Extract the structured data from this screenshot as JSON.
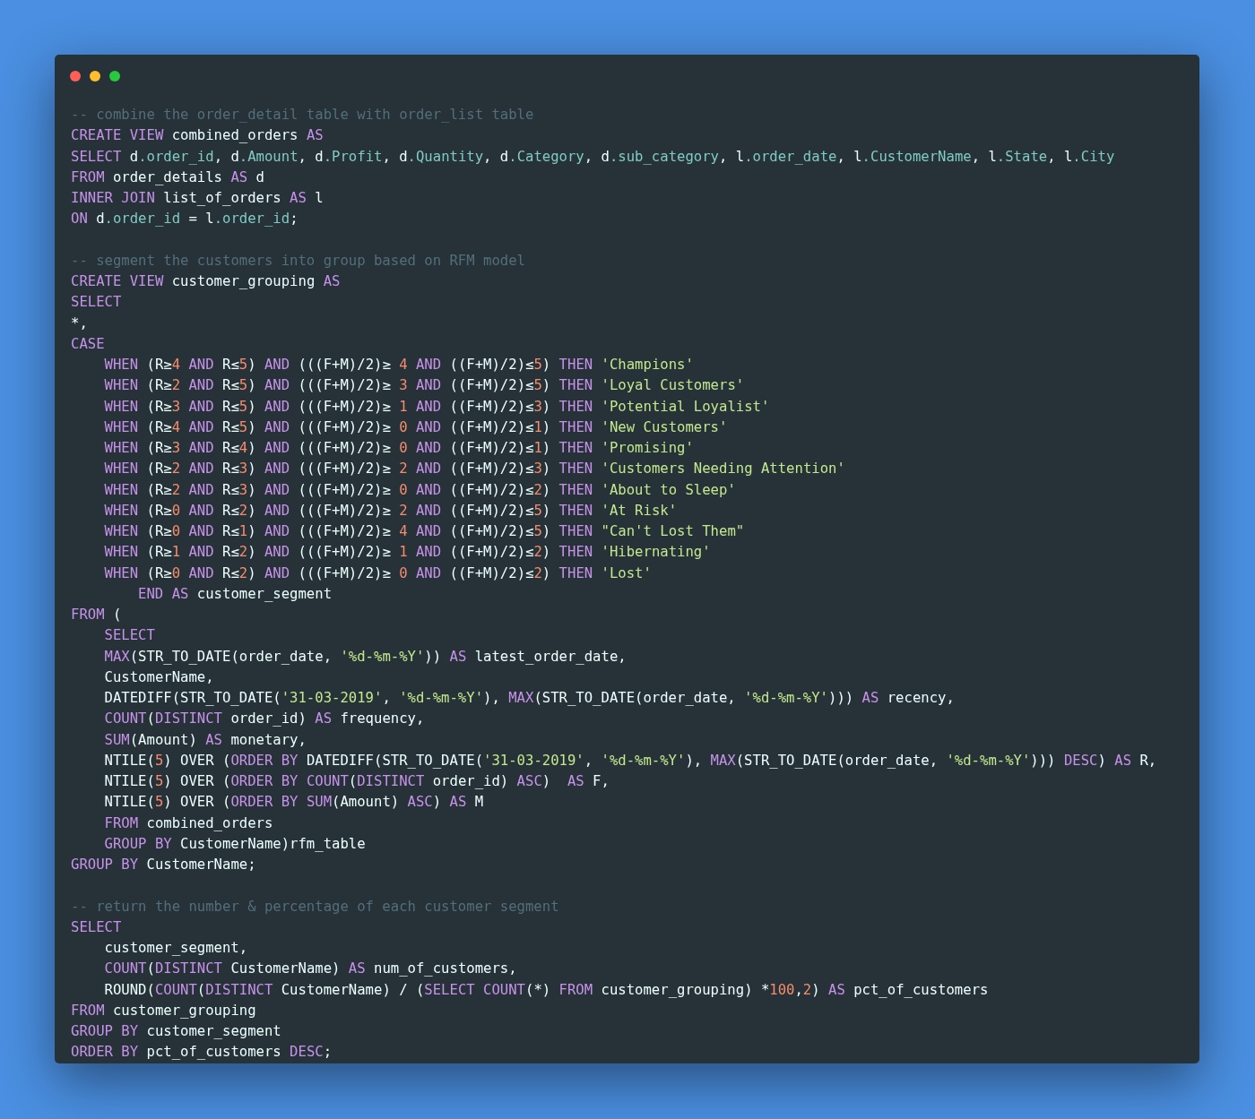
{
  "window": {
    "controls": [
      {
        "color": "#ff5f56"
      },
      {
        "color": "#ffbd2e"
      },
      {
        "color": "#27c93f"
      }
    ]
  },
  "code": {
    "blocks": [
      {
        "lines": [
          {
            "kind": "top",
            "tokens": [
              {
                "kind": "comment",
                "text": "-- combine the order_detail table with order_list table"
              }
            ]
          },
          {
            "kind": "top",
            "tokens": [
              {
                "kind": "keyword",
                "text": "CREATE VIEW"
              },
              {
                "kind": "text",
                "text": " combined_orders "
              },
              {
                "kind": "keyword",
                "text": "AS"
              }
            ]
          },
          {
            "kind": "top",
            "tokens": [
              {
                "kind": "keyword",
                "text": "SELECT"
              },
              {
                "kind": "text",
                "text": " d"
              },
              {
                "kind": "field",
                "text": ".order_id"
              },
              {
                "kind": "text",
                "text": ", d"
              },
              {
                "kind": "field",
                "text": ".Amount"
              },
              {
                "kind": "text",
                "text": ", d"
              },
              {
                "kind": "field",
                "text": ".Profit"
              },
              {
                "kind": "text",
                "text": ", d"
              },
              {
                "kind": "field",
                "text": ".Quantity"
              },
              {
                "kind": "text",
                "text": ", d"
              },
              {
                "kind": "field",
                "text": ".Category"
              },
              {
                "kind": "text",
                "text": ", d"
              },
              {
                "kind": "field",
                "text": ".sub_category"
              },
              {
                "kind": "text",
                "text": ", l"
              },
              {
                "kind": "field",
                "text": ".order_date"
              },
              {
                "kind": "text",
                "text": ", l"
              },
              {
                "kind": "field",
                "text": ".CustomerName"
              },
              {
                "kind": "text",
                "text": ", l"
              },
              {
                "kind": "field",
                "text": ".State"
              },
              {
                "kind": "text",
                "text": ", l"
              },
              {
                "kind": "field",
                "text": ".City"
              }
            ]
          },
          {
            "kind": "top",
            "tokens": [
              {
                "kind": "keyword",
                "text": "FROM"
              },
              {
                "kind": "text",
                "text": " order_details "
              },
              {
                "kind": "keyword",
                "text": "AS"
              },
              {
                "kind": "text",
                "text": " d"
              }
            ]
          },
          {
            "kind": "top",
            "tokens": [
              {
                "kind": "keyword",
                "text": "INNER JOIN"
              },
              {
                "kind": "text",
                "text": " list_of_orders "
              },
              {
                "kind": "keyword",
                "text": "AS"
              },
              {
                "kind": "text",
                "text": " l"
              }
            ]
          },
          {
            "kind": "top",
            "tokens": [
              {
                "kind": "keyword",
                "text": "ON"
              },
              {
                "kind": "text",
                "text": " d"
              },
              {
                "kind": "field",
                "text": ".order_id"
              },
              {
                "kind": "text",
                "text": " = l"
              },
              {
                "kind": "field",
                "text": ".order_id"
              },
              {
                "kind": "text",
                "text": ";"
              }
            ]
          }
        ]
      },
      {
        "lines": [
          {
            "kind": "top",
            "tokens": [
              {
                "kind": "comment",
                "text": "-- segment the customers into group based on RFM model"
              }
            ]
          },
          {
            "kind": "top",
            "tokens": [
              {
                "kind": "keyword",
                "text": "CREATE VIEW"
              },
              {
                "kind": "text",
                "text": " customer_grouping "
              },
              {
                "kind": "keyword",
                "text": "AS"
              }
            ]
          },
          {
            "kind": "top",
            "tokens": [
              {
                "kind": "keyword",
                "text": "SELECT"
              }
            ]
          },
          {
            "kind": "top",
            "tokens": [
              {
                "kind": "text",
                "text": "*,"
              }
            ]
          },
          {
            "kind": "top",
            "tokens": [
              {
                "kind": "keyword",
                "text": "CASE"
              }
            ]
          },
          {
            "kind": "indent",
            "tokens": [
              {
                "kind": "keyword",
                "text": "WHEN"
              },
              {
                "kind": "text",
                "text": " (R≥"
              },
              {
                "kind": "number",
                "text": "4"
              },
              {
                "kind": "keyword",
                "text": " AND"
              },
              {
                "kind": "text",
                "text": " R≤"
              },
              {
                "kind": "number",
                "text": "5"
              },
              {
                "kind": "text",
                "text": ") "
              },
              {
                "kind": "keyword",
                "text": "AND"
              },
              {
                "kind": "text",
                "text": " (((F+M)/2)≥ "
              },
              {
                "kind": "number",
                "text": "4"
              },
              {
                "kind": "keyword",
                "text": " AND"
              },
              {
                "kind": "text",
                "text": " ((F+M)/2)≤"
              },
              {
                "kind": "number",
                "text": "5"
              },
              {
                "kind": "text",
                "text": ") "
              },
              {
                "kind": "keyword",
                "text": "THEN"
              },
              {
                "kind": "string",
                "text": " 'Champions'"
              }
            ]
          },
          {
            "kind": "indent",
            "tokens": [
              {
                "kind": "keyword",
                "text": "WHEN"
              },
              {
                "kind": "text",
                "text": " (R≥"
              },
              {
                "kind": "number",
                "text": "2"
              },
              {
                "kind": "keyword",
                "text": " AND"
              },
              {
                "kind": "text",
                "text": " R≤"
              },
              {
                "kind": "number",
                "text": "5"
              },
              {
                "kind": "text",
                "text": ") "
              },
              {
                "kind": "keyword",
                "text": "AND"
              },
              {
                "kind": "text",
                "text": " (((F+M)/2)≥ "
              },
              {
                "kind": "number",
                "text": "3"
              },
              {
                "kind": "keyword",
                "text": " AND"
              },
              {
                "kind": "text",
                "text": " ((F+M)/2)≤"
              },
              {
                "kind": "number",
                "text": "5"
              },
              {
                "kind": "text",
                "text": ") "
              },
              {
                "kind": "keyword",
                "text": "THEN"
              },
              {
                "kind": "string",
                "text": " 'Loyal Customers'"
              }
            ]
          },
          {
            "kind": "indent",
            "tokens": [
              {
                "kind": "keyword",
                "text": "WHEN"
              },
              {
                "kind": "text",
                "text": " (R≥"
              },
              {
                "kind": "number",
                "text": "3"
              },
              {
                "kind": "keyword",
                "text": " AND"
              },
              {
                "kind": "text",
                "text": " R≤"
              },
              {
                "kind": "number",
                "text": "5"
              },
              {
                "kind": "text",
                "text": ") "
              },
              {
                "kind": "keyword",
                "text": "AND"
              },
              {
                "kind": "text",
                "text": " (((F+M)/2)≥ "
              },
              {
                "kind": "number",
                "text": "1"
              },
              {
                "kind": "keyword",
                "text": " AND"
              },
              {
                "kind": "text",
                "text": " ((F+M)/2)≤"
              },
              {
                "kind": "number",
                "text": "3"
              },
              {
                "kind": "text",
                "text": ") "
              },
              {
                "kind": "keyword",
                "text": "THEN"
              },
              {
                "kind": "string",
                "text": " 'Potential Loyalist'"
              }
            ]
          },
          {
            "kind": "indent",
            "tokens": [
              {
                "kind": "keyword",
                "text": "WHEN"
              },
              {
                "kind": "text",
                "text": " (R≥"
              },
              {
                "kind": "number",
                "text": "4"
              },
              {
                "kind": "keyword",
                "text": " AND"
              },
              {
                "kind": "text",
                "text": " R≤"
              },
              {
                "kind": "number",
                "text": "5"
              },
              {
                "kind": "text",
                "text": ") "
              },
              {
                "kind": "keyword",
                "text": "AND"
              },
              {
                "kind": "text",
                "text": " (((F+M)/2)≥ "
              },
              {
                "kind": "number",
                "text": "0"
              },
              {
                "kind": "keyword",
                "text": " AND"
              },
              {
                "kind": "text",
                "text": " ((F+M)/2)≤"
              },
              {
                "kind": "number",
                "text": "1"
              },
              {
                "kind": "text",
                "text": ") "
              },
              {
                "kind": "keyword",
                "text": "THEN"
              },
              {
                "kind": "string",
                "text": " 'New Customers'"
              }
            ]
          },
          {
            "kind": "indent",
            "tokens": [
              {
                "kind": "keyword",
                "text": "WHEN"
              },
              {
                "kind": "text",
                "text": " (R≥"
              },
              {
                "kind": "number",
                "text": "3"
              },
              {
                "kind": "keyword",
                "text": " AND"
              },
              {
                "kind": "text",
                "text": " R≤"
              },
              {
                "kind": "number",
                "text": "4"
              },
              {
                "kind": "text",
                "text": ") "
              },
              {
                "kind": "keyword",
                "text": "AND"
              },
              {
                "kind": "text",
                "text": " (((F+M)/2)≥ "
              },
              {
                "kind": "number",
                "text": "0"
              },
              {
                "kind": "keyword",
                "text": " AND"
              },
              {
                "kind": "text",
                "text": " ((F+M)/2)≤"
              },
              {
                "kind": "number",
                "text": "1"
              },
              {
                "kind": "text",
                "text": ") "
              },
              {
                "kind": "keyword",
                "text": "THEN"
              },
              {
                "kind": "string",
                "text": " 'Promising'"
              }
            ]
          },
          {
            "kind": "indent",
            "tokens": [
              {
                "kind": "keyword",
                "text": "WHEN"
              },
              {
                "kind": "text",
                "text": " (R≥"
              },
              {
                "kind": "number",
                "text": "2"
              },
              {
                "kind": "keyword",
                "text": " AND"
              },
              {
                "kind": "text",
                "text": " R≤"
              },
              {
                "kind": "number",
                "text": "3"
              },
              {
                "kind": "text",
                "text": ") "
              },
              {
                "kind": "keyword",
                "text": "AND"
              },
              {
                "kind": "text",
                "text": " (((F+M)/2)≥ "
              },
              {
                "kind": "number",
                "text": "2"
              },
              {
                "kind": "keyword",
                "text": " AND"
              },
              {
                "kind": "text",
                "text": " ((F+M)/2)≤"
              },
              {
                "kind": "number",
                "text": "3"
              },
              {
                "kind": "text",
                "text": ") "
              },
              {
                "kind": "keyword",
                "text": "THEN"
              },
              {
                "kind": "string",
                "text": " 'Customers Needing Attention'"
              }
            ]
          },
          {
            "kind": "indent",
            "tokens": [
              {
                "kind": "keyword",
                "text": "WHEN"
              },
              {
                "kind": "text",
                "text": " (R≥"
              },
              {
                "kind": "number",
                "text": "2"
              },
              {
                "kind": "keyword",
                "text": " AND"
              },
              {
                "kind": "text",
                "text": " R≤"
              },
              {
                "kind": "number",
                "text": "3"
              },
              {
                "kind": "text",
                "text": ") "
              },
              {
                "kind": "keyword",
                "text": "AND"
              },
              {
                "kind": "text",
                "text": " (((F+M)/2)≥ "
              },
              {
                "kind": "number",
                "text": "0"
              },
              {
                "kind": "keyword",
                "text": " AND"
              },
              {
                "kind": "text",
                "text": " ((F+M)/2)≤"
              },
              {
                "kind": "number",
                "text": "2"
              },
              {
                "kind": "text",
                "text": ") "
              },
              {
                "kind": "keyword",
                "text": "THEN"
              },
              {
                "kind": "string",
                "text": " 'About to Sleep'"
              }
            ]
          },
          {
            "kind": "indent",
            "tokens": [
              {
                "kind": "keyword",
                "text": "WHEN"
              },
              {
                "kind": "text",
                "text": " (R≥"
              },
              {
                "kind": "number",
                "text": "0"
              },
              {
                "kind": "keyword",
                "text": " AND"
              },
              {
                "kind": "text",
                "text": " R≤"
              },
              {
                "kind": "number",
                "text": "2"
              },
              {
                "kind": "text",
                "text": ") "
              },
              {
                "kind": "keyword",
                "text": "AND"
              },
              {
                "kind": "text",
                "text": " (((F+M)/2)≥ "
              },
              {
                "kind": "number",
                "text": "2"
              },
              {
                "kind": "keyword",
                "text": " AND"
              },
              {
                "kind": "text",
                "text": " ((F+M)/2)≤"
              },
              {
                "kind": "number",
                "text": "5"
              },
              {
                "kind": "text",
                "text": ") "
              },
              {
                "kind": "keyword",
                "text": "THEN"
              },
              {
                "kind": "string",
                "text": " 'At Risk'"
              }
            ]
          },
          {
            "kind": "indent",
            "tokens": [
              {
                "kind": "keyword",
                "text": "WHEN"
              },
              {
                "kind": "text",
                "text": " (R≥"
              },
              {
                "kind": "number",
                "text": "0"
              },
              {
                "kind": "keyword",
                "text": " AND"
              },
              {
                "kind": "text",
                "text": " R≤"
              },
              {
                "kind": "number",
                "text": "1"
              },
              {
                "kind": "text",
                "text": ") "
              },
              {
                "kind": "keyword",
                "text": "AND"
              },
              {
                "kind": "text",
                "text": " (((F+M)/2)≥ "
              },
              {
                "kind": "number",
                "text": "4"
              },
              {
                "kind": "keyword",
                "text": " AND"
              },
              {
                "kind": "text",
                "text": " ((F+M)/2)≤"
              },
              {
                "kind": "number",
                "text": "5"
              },
              {
                "kind": "text",
                "text": ") "
              },
              {
                "kind": "keyword",
                "text": "THEN"
              },
              {
                "kind": "string",
                "text": " \"Can't Lost Them\""
              }
            ]
          },
          {
            "kind": "indent",
            "tokens": [
              {
                "kind": "keyword",
                "text": "WHEN"
              },
              {
                "kind": "text",
                "text": " (R≥"
              },
              {
                "kind": "number",
                "text": "1"
              },
              {
                "kind": "keyword",
                "text": " AND"
              },
              {
                "kind": "text",
                "text": " R≤"
              },
              {
                "kind": "number",
                "text": "2"
              },
              {
                "kind": "text",
                "text": ") "
              },
              {
                "kind": "keyword",
                "text": "AND"
              },
              {
                "kind": "text",
                "text": " (((F+M)/2)≥ "
              },
              {
                "kind": "number",
                "text": "1"
              },
              {
                "kind": "keyword",
                "text": " AND"
              },
              {
                "kind": "text",
                "text": " ((F+M)/2)≤"
              },
              {
                "kind": "number",
                "text": "2"
              },
              {
                "kind": "text",
                "text": ") "
              },
              {
                "kind": "keyword",
                "text": "THEN"
              },
              {
                "kind": "string",
                "text": " 'Hibernating'"
              }
            ]
          },
          {
            "kind": "indent",
            "tokens": [
              {
                "kind": "keyword",
                "text": "WHEN"
              },
              {
                "kind": "text",
                "text": " (R≥"
              },
              {
                "kind": "number",
                "text": "0"
              },
              {
                "kind": "keyword",
                "text": " AND"
              },
              {
                "kind": "text",
                "text": " R≤"
              },
              {
                "kind": "number",
                "text": "2"
              },
              {
                "kind": "text",
                "text": ") "
              },
              {
                "kind": "keyword",
                "text": "AND"
              },
              {
                "kind": "text",
                "text": " (((F+M)/2)≥ "
              },
              {
                "kind": "number",
                "text": "0"
              },
              {
                "kind": "keyword",
                "text": " AND"
              },
              {
                "kind": "text",
                "text": " ((F+M)/2)≤"
              },
              {
                "kind": "number",
                "text": "2"
              },
              {
                "kind": "text",
                "text": ") "
              },
              {
                "kind": "keyword",
                "text": "THEN"
              },
              {
                "kind": "string",
                "text": " 'Lost'"
              }
            ]
          },
          {
            "kind": "deep",
            "tokens": [
              {
                "kind": "keyword",
                "text": "END AS"
              },
              {
                "kind": "text",
                "text": " customer_segment"
              }
            ]
          },
          {
            "kind": "top",
            "tokens": [
              {
                "kind": "keyword",
                "text": "FROM"
              },
              {
                "kind": "text",
                "text": " ("
              }
            ]
          },
          {
            "kind": "indent",
            "tokens": [
              {
                "kind": "keyword",
                "text": "SELECT"
              }
            ]
          },
          {
            "kind": "indent",
            "tokens": [
              {
                "kind": "keyword",
                "text": "MAX"
              },
              {
                "kind": "text",
                "text": "(STR_TO_DATE(order_date, "
              },
              {
                "kind": "string",
                "text": "'%d-%m-%Y'"
              },
              {
                "kind": "text",
                "text": ")) "
              },
              {
                "kind": "keyword",
                "text": "AS"
              },
              {
                "kind": "text",
                "text": " latest_order_date,"
              }
            ]
          },
          {
            "kind": "indent",
            "tokens": [
              {
                "kind": "text",
                "text": "CustomerName,"
              }
            ]
          },
          {
            "kind": "indent",
            "tokens": [
              {
                "kind": "text",
                "text": "DATEDIFF(STR_TO_DATE("
              },
              {
                "kind": "string",
                "text": "'31-03-2019'"
              },
              {
                "kind": "text",
                "text": ", "
              },
              {
                "kind": "string",
                "text": "'%d-%m-%Y'"
              },
              {
                "kind": "text",
                "text": "), "
              },
              {
                "kind": "keyword",
                "text": "MAX"
              },
              {
                "kind": "text",
                "text": "(STR_TO_DATE(order_date, "
              },
              {
                "kind": "string",
                "text": "'%d-%m-%Y'"
              },
              {
                "kind": "text",
                "text": "))) "
              },
              {
                "kind": "keyword",
                "text": "AS"
              },
              {
                "kind": "text",
                "text": " recency,"
              }
            ]
          },
          {
            "kind": "indent",
            "tokens": [
              {
                "kind": "keyword",
                "text": "COUNT"
              },
              {
                "kind": "text",
                "text": "("
              },
              {
                "kind": "keyword",
                "text": "DISTINCT"
              },
              {
                "kind": "text",
                "text": " order_id) "
              },
              {
                "kind": "keyword",
                "text": "AS"
              },
              {
                "kind": "text",
                "text": " frequency,"
              }
            ]
          },
          {
            "kind": "indent",
            "tokens": [
              {
                "kind": "keyword",
                "text": "SUM"
              },
              {
                "kind": "text",
                "text": "(Amount) "
              },
              {
                "kind": "keyword",
                "text": "AS"
              },
              {
                "kind": "text",
                "text": " monetary,"
              }
            ]
          },
          {
            "kind": "indent",
            "tokens": [
              {
                "kind": "text",
                "text": "NTILE("
              },
              {
                "kind": "number",
                "text": "5"
              },
              {
                "kind": "text",
                "text": ") OVER ("
              },
              {
                "kind": "keyword",
                "text": "ORDER BY"
              },
              {
                "kind": "text",
                "text": " DATEDIFF(STR_TO_DATE("
              },
              {
                "kind": "string",
                "text": "'31-03-2019'"
              },
              {
                "kind": "text",
                "text": ", "
              },
              {
                "kind": "string",
                "text": "'%d-%m-%Y'"
              },
              {
                "kind": "text",
                "text": "), "
              },
              {
                "kind": "keyword",
                "text": "MAX"
              },
              {
                "kind": "text",
                "text": "(STR_TO_DATE(order_date, "
              },
              {
                "kind": "string",
                "text": "'%d-%m-%Y'"
              },
              {
                "kind": "text",
                "text": "))) "
              },
              {
                "kind": "keyword",
                "text": "DESC"
              },
              {
                "kind": "text",
                "text": ") "
              },
              {
                "kind": "keyword",
                "text": "AS"
              },
              {
                "kind": "text",
                "text": " R,"
              }
            ]
          },
          {
            "kind": "indent",
            "tokens": [
              {
                "kind": "text",
                "text": "NTILE("
              },
              {
                "kind": "number",
                "text": "5"
              },
              {
                "kind": "text",
                "text": ") OVER ("
              },
              {
                "kind": "keyword",
                "text": "ORDER BY COUNT"
              },
              {
                "kind": "text",
                "text": "("
              },
              {
                "kind": "keyword",
                "text": "DISTINCT"
              },
              {
                "kind": "text",
                "text": " order_id) "
              },
              {
                "kind": "keyword",
                "text": "ASC"
              },
              {
                "kind": "text",
                "text": ")  "
              },
              {
                "kind": "keyword",
                "text": "AS"
              },
              {
                "kind": "text",
                "text": " F,"
              }
            ]
          },
          {
            "kind": "indent",
            "tokens": [
              {
                "kind": "text",
                "text": "NTILE("
              },
              {
                "kind": "number",
                "text": "5"
              },
              {
                "kind": "text",
                "text": ") OVER ("
              },
              {
                "kind": "keyword",
                "text": "ORDER BY SUM"
              },
              {
                "kind": "text",
                "text": "(Amount) "
              },
              {
                "kind": "keyword",
                "text": "ASC"
              },
              {
                "kind": "text",
                "text": ") "
              },
              {
                "kind": "keyword",
                "text": "AS"
              },
              {
                "kind": "text",
                "text": " M"
              }
            ]
          },
          {
            "kind": "indent",
            "tokens": [
              {
                "kind": "keyword",
                "text": "FROM"
              },
              {
                "kind": "text",
                "text": " combined_orders"
              }
            ]
          },
          {
            "kind": "indent",
            "tokens": [
              {
                "kind": "keyword",
                "text": "GROUP BY"
              },
              {
                "kind": "text",
                "text": " CustomerName)rfm_table"
              }
            ]
          },
          {
            "kind": "top",
            "tokens": [
              {
                "kind": "keyword",
                "text": "GROUP BY"
              },
              {
                "kind": "text",
                "text": " CustomerName;"
              }
            ]
          }
        ]
      },
      {
        "lines": [
          {
            "kind": "top",
            "tokens": [
              {
                "kind": "comment",
                "text": "-- return the number & percentage of each customer segment"
              }
            ]
          },
          {
            "kind": "top",
            "tokens": [
              {
                "kind": "keyword",
                "text": "SELECT"
              }
            ]
          },
          {
            "kind": "indent",
            "tokens": [
              {
                "kind": "text",
                "text": "customer_segment,"
              }
            ]
          },
          {
            "kind": "indent",
            "tokens": [
              {
                "kind": "keyword",
                "text": "COUNT"
              },
              {
                "kind": "text",
                "text": "("
              },
              {
                "kind": "keyword",
                "text": "DISTINCT"
              },
              {
                "kind": "text",
                "text": " CustomerName) "
              },
              {
                "kind": "keyword",
                "text": "AS"
              },
              {
                "kind": "text",
                "text": " num_of_customers,"
              }
            ]
          },
          {
            "kind": "indent",
            "tokens": [
              {
                "kind": "text",
                "text": "ROUND("
              },
              {
                "kind": "keyword",
                "text": "COUNT"
              },
              {
                "kind": "text",
                "text": "("
              },
              {
                "kind": "keyword",
                "text": "DISTINCT"
              },
              {
                "kind": "text",
                "text": " CustomerName) / ("
              },
              {
                "kind": "keyword",
                "text": "SELECT COUNT"
              },
              {
                "kind": "text",
                "text": "(*) "
              },
              {
                "kind": "keyword",
                "text": "FROM"
              },
              {
                "kind": "text",
                "text": " customer_grouping) *"
              },
              {
                "kind": "number",
                "text": "100"
              },
              {
                "kind": "text",
                "text": ","
              },
              {
                "kind": "number",
                "text": "2"
              },
              {
                "kind": "text",
                "text": ") "
              },
              {
                "kind": "keyword",
                "text": "AS"
              },
              {
                "kind": "text",
                "text": " pct_of_customers"
              }
            ]
          },
          {
            "kind": "top",
            "tokens": [
              {
                "kind": "keyword",
                "text": "FROM"
              },
              {
                "kind": "text",
                "text": " customer_grouping"
              }
            ]
          },
          {
            "kind": "top",
            "tokens": [
              {
                "kind": "keyword",
                "text": "GROUP BY"
              },
              {
                "kind": "text",
                "text": " customer_segment"
              }
            ]
          },
          {
            "kind": "top",
            "tokens": [
              {
                "kind": "keyword",
                "text": "ORDER BY"
              },
              {
                "kind": "text",
                "text": " pct_of_customers "
              },
              {
                "kind": "keyword",
                "text": "DESC"
              },
              {
                "kind": "text",
                "text": ";"
              }
            ]
          }
        ]
      }
    ]
  }
}
